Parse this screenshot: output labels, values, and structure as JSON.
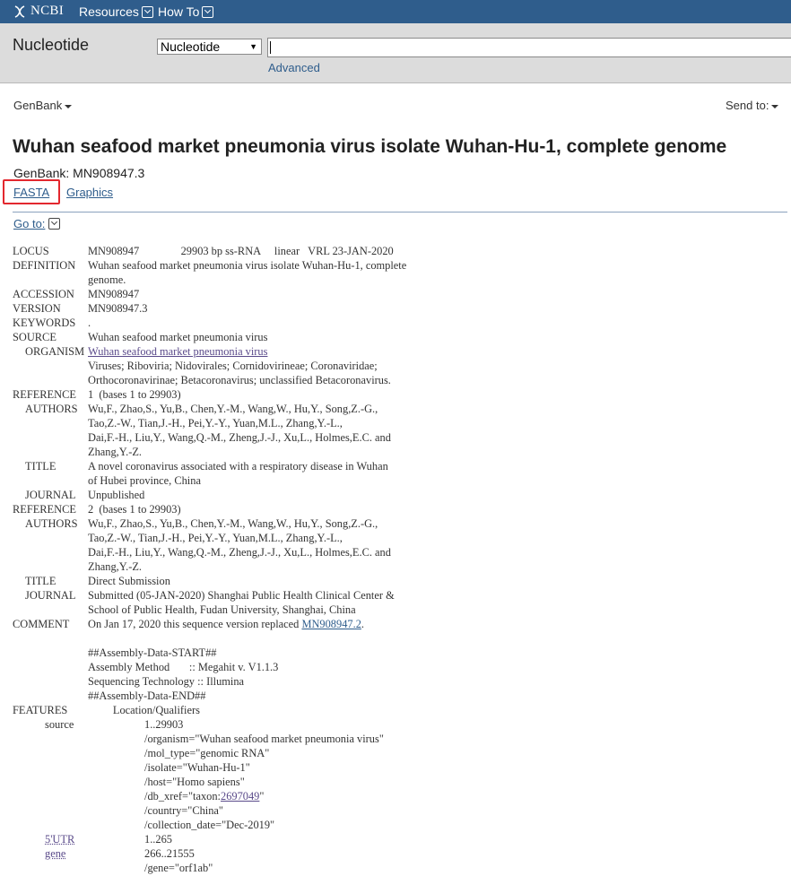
{
  "topbar": {
    "logo_text": "NCBI",
    "menus": [
      "Resources",
      "How To"
    ]
  },
  "search": {
    "db_title": "Nucleotide",
    "db_selected": "Nucleotide",
    "advanced": "Advanced",
    "query": ""
  },
  "subheader": {
    "format": "GenBank",
    "send_to": "Send to:"
  },
  "record": {
    "title": "Wuhan seafood market pneumonia virus isolate Wuhan-Hu-1, complete genome",
    "accession_line": "GenBank: MN908947.3",
    "fasta_link": "FASTA",
    "graphics_link": "Graphics",
    "goto": "Go to:"
  },
  "flatfile": {
    "lines": [
      {
        "k": "LOCUS",
        "v": "MN908947               29903 bp ss-RNA     linear   VRL 23-JAN-2020"
      },
      {
        "k": "DEFINITION",
        "v": "Wuhan seafood market pneumonia virus isolate Wuhan-Hu-1, complete"
      },
      {
        "k": "",
        "v": "genome."
      },
      {
        "k": "ACCESSION",
        "v": "MN908947"
      },
      {
        "k": "VERSION",
        "v": "MN908947.3"
      },
      {
        "k": "KEYWORDS",
        "v": "."
      },
      {
        "k": "SOURCE",
        "v": "Wuhan seafood market pneumonia virus"
      },
      {
        "k": "ORGANISM",
        "sub": true,
        "link": "Wuhan seafood market pneumonia virus"
      },
      {
        "k": "",
        "v": "Viruses; Riboviria; Nidovirales; Cornidovirineae; Coronaviridae;"
      },
      {
        "k": "",
        "v": "Orthocoronavirinae; Betacoronavirus; unclassified Betacoronavirus."
      },
      {
        "k": "REFERENCE",
        "v": "1  (bases 1 to 29903)"
      },
      {
        "k": "AUTHORS",
        "sub": true,
        "v": "Wu,F., Zhao,S., Yu,B., Chen,Y.-M., Wang,W., Hu,Y., Song,Z.-G.,"
      },
      {
        "k": "",
        "v": "Tao,Z.-W., Tian,J.-H., Pei,Y.-Y., Yuan,M.L., Zhang,Y.-L.,"
      },
      {
        "k": "",
        "v": "Dai,F.-H., Liu,Y., Wang,Q.-M., Zheng,J.-J., Xu,L., Holmes,E.C. and"
      },
      {
        "k": "",
        "v": "Zhang,Y.-Z."
      },
      {
        "k": "TITLE",
        "sub": true,
        "v": "A novel coronavirus associated with a respiratory disease in Wuhan"
      },
      {
        "k": "",
        "v": "of Hubei province, China"
      },
      {
        "k": "JOURNAL",
        "sub": true,
        "v": "Unpublished"
      },
      {
        "k": "REFERENCE",
        "v": "2  (bases 1 to 29903)"
      },
      {
        "k": "AUTHORS",
        "sub": true,
        "v": "Wu,F., Zhao,S., Yu,B., Chen,Y.-M., Wang,W., Hu,Y., Song,Z.-G.,"
      },
      {
        "k": "",
        "v": "Tao,Z.-W., Tian,J.-H., Pei,Y.-Y., Yuan,M.L., Zhang,Y.-L.,"
      },
      {
        "k": "",
        "v": "Dai,F.-H., Liu,Y., Wang,Q.-M., Zheng,J.-J., Xu,L., Holmes,E.C. and"
      },
      {
        "k": "",
        "v": "Zhang,Y.-Z."
      },
      {
        "k": "TITLE",
        "sub": true,
        "v": "Direct Submission"
      },
      {
        "k": "JOURNAL",
        "sub": true,
        "v": "Submitted (05-JAN-2020) Shanghai Public Health Clinical Center &"
      },
      {
        "k": "",
        "v": "School of Public Health, Fudan University, Shanghai, China"
      },
      {
        "k": "COMMENT",
        "v": "On Jan 17, 2020 this sequence version replaced ",
        "link2": "MN908947.2",
        "tail": "."
      },
      {
        "k": "",
        "v": ""
      },
      {
        "k": "",
        "v": "##Assembly-Data-START##"
      },
      {
        "k": "",
        "v": "Assembly Method       :: Megahit v. V1.1.3"
      },
      {
        "k": "",
        "v": "Sequencing Technology :: Illumina"
      },
      {
        "k": "",
        "v": "##Assembly-Data-END##"
      },
      {
        "k": "FEATURES",
        "v": "         Location/Qualifiers"
      },
      {
        "k": "source",
        "feat": true,
        "v": "1..29903"
      },
      {
        "k": "",
        "featv": true,
        "v": "/organism=\"Wuhan seafood market pneumonia virus\""
      },
      {
        "k": "",
        "featv": true,
        "v": "/mol_type=\"genomic RNA\""
      },
      {
        "k": "",
        "featv": true,
        "v": "/isolate=\"Wuhan-Hu-1\""
      },
      {
        "k": "",
        "featv": true,
        "v": "/host=\"Homo sapiens\""
      },
      {
        "k": "",
        "featv": true,
        "v": "/db_xref=\"taxon:",
        "link": "2697049",
        "tail": "\""
      },
      {
        "k": "",
        "featv": true,
        "v": "/country=\"China\""
      },
      {
        "k": "",
        "featv": true,
        "v": "/collection_date=\"Dec-2019\""
      },
      {
        "k": "5'UTR",
        "feat": true,
        "featlink": true,
        "v": "1..265"
      },
      {
        "k": "gene",
        "feat": true,
        "featlink": true,
        "v": "266..21555"
      },
      {
        "k": "",
        "featv": true,
        "v": "/gene=\"orf1ab\""
      }
    ]
  }
}
